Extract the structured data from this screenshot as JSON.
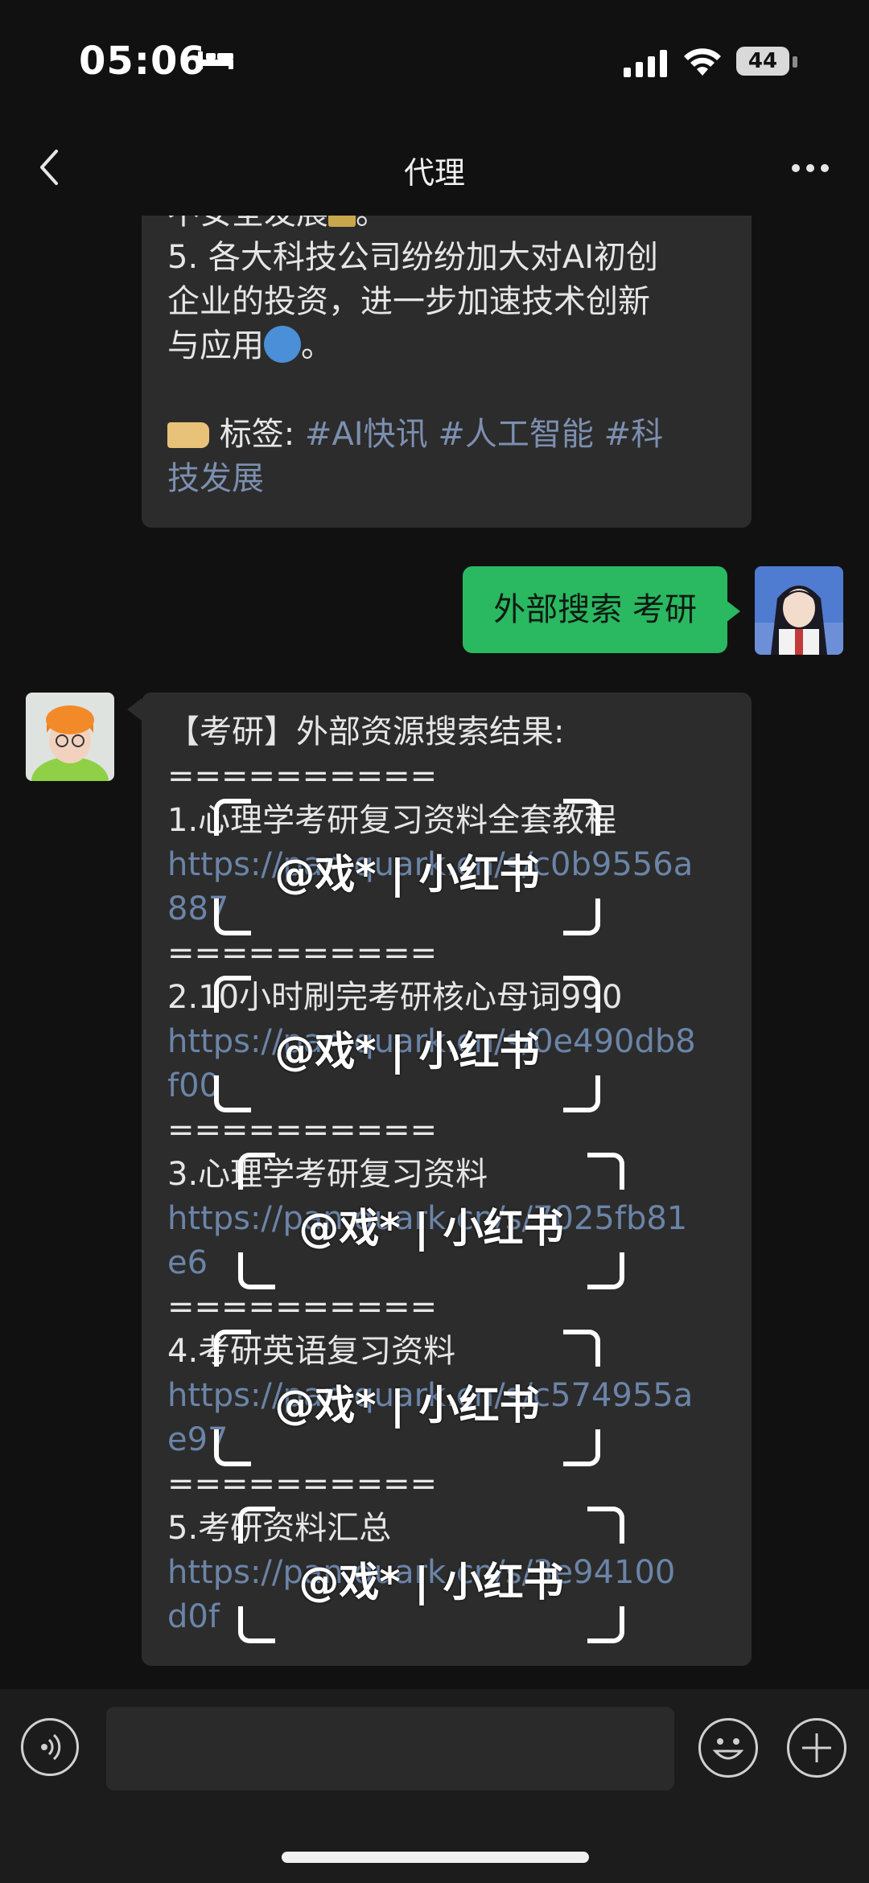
{
  "status": {
    "time": "05:06",
    "battery": "44"
  },
  "nav": {
    "title": "代理"
  },
  "messages": {
    "first": {
      "lines": [
        "不安全发展",
        "5. 各大科技公司纷纷加大对AI初创",
        "企业的投资，进一步加速技术创新",
        "与应用"
      ],
      "line0_tail": "。",
      "line3_tail": "。",
      "tag_label": "标签:",
      "tags": [
        "#AI快讯",
        "#人工智能",
        "#科",
        "技发展"
      ]
    },
    "outgoing": {
      "text": "外部搜索 考研"
    },
    "result": {
      "header": "【考研】外部资源搜索结果:",
      "separator": "==========",
      "items": [
        {
          "title": "1.心理学考研复习资料全套教程",
          "link1": "https://pan.quark.cn/s/c0b9556a",
          "link2": "887"
        },
        {
          "title": "2.10小时刷完考研核心母词990",
          "link1": "https://pan.quark.cn/s/0e490db8",
          "link2": "f00"
        },
        {
          "title": "3.心理学考研复习资料",
          "link1": "https://pan.quark.cn/s/7025fb81",
          "link2": "e6"
        },
        {
          "title": "4.考研英语复习资料",
          "link1": "https://pan.quark.cn/s/c574955a",
          "link2": "e97"
        },
        {
          "title": "5.考研资料汇总",
          "link1": "https://pan.quark.cn/s/3e94100",
          "link2": "d0f"
        }
      ]
    }
  },
  "watermark": {
    "text": "@戏* | 小红书"
  },
  "icons": {
    "back": "chevron-left-icon",
    "more": "more-dots-icon",
    "voice": "voice-icon",
    "emoji": "emoji-icon",
    "plus": "plus-icon"
  }
}
